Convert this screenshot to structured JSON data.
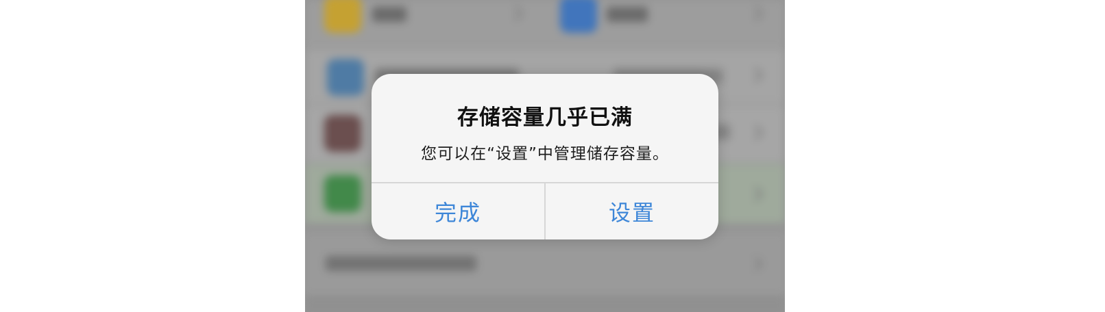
{
  "alert": {
    "title": "存储容量几乎已满",
    "message": "您可以在“设置”中管理储存容量。",
    "buttons": {
      "done": "完成",
      "settings": "设置"
    }
  },
  "colors": {
    "button_text": "#3d86d8",
    "alert_background": "#f5f5f5",
    "backdrop": "#a9a9a9"
  },
  "background_icons": [
    "folder-app-icon",
    "blue-app-icon",
    "app-icon",
    "photo-app-icon",
    "green-app-icon"
  ]
}
